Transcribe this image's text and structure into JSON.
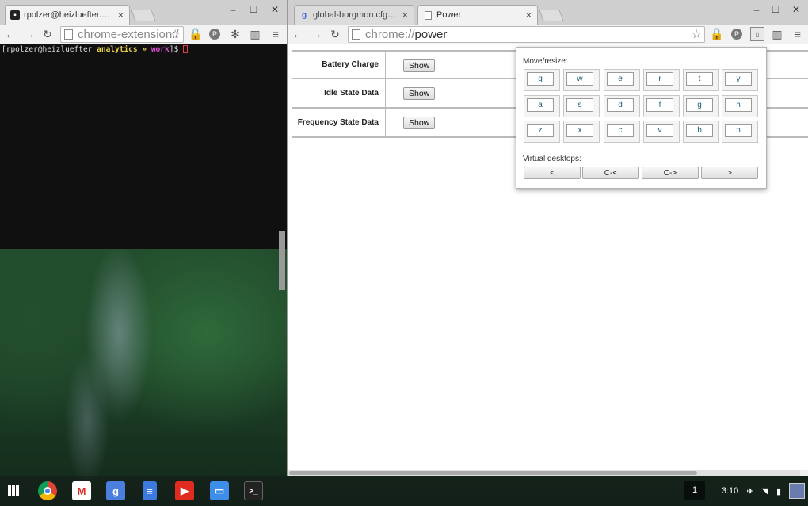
{
  "left_window": {
    "tab_title": "rpolzer@heizluefter.zrh",
    "address": "chrome-extension:/",
    "terminal": {
      "user_host": "rpolzer@heizluefter",
      "dir": "analytics",
      "arrow": "»",
      "branch": "work",
      "prompt_suffix": "]$"
    }
  },
  "right_window": {
    "tabs": [
      {
        "title": "global-borgmon.cfg - Co"
      },
      {
        "title": "Power"
      }
    ],
    "address_scheme": "chrome://",
    "address_host": "power",
    "rows": [
      {
        "label": "Battery Charge",
        "button": "Show"
      },
      {
        "label": "Idle State Data",
        "button": "Show"
      },
      {
        "label": "Frequency State Data",
        "button": "Show"
      }
    ]
  },
  "popup": {
    "move_resize_label": "Move/resize:",
    "keys_row1": [
      "q",
      "w",
      "e",
      "r",
      "t",
      "y"
    ],
    "keys_row2": [
      "a",
      "s",
      "d",
      "f",
      "g",
      "h"
    ],
    "keys_row3": [
      "z",
      "x",
      "c",
      "v",
      "b",
      "n"
    ],
    "virtual_desktops_label": "Virtual desktops:",
    "desktop_buttons": [
      "<",
      "C-<",
      "C->",
      ">"
    ]
  },
  "shelf": {
    "workspace": "1",
    "time": "3:10",
    "apps": [
      "chrome",
      "gmail",
      "google-search",
      "docs",
      "youtube",
      "files",
      "terminal"
    ]
  }
}
